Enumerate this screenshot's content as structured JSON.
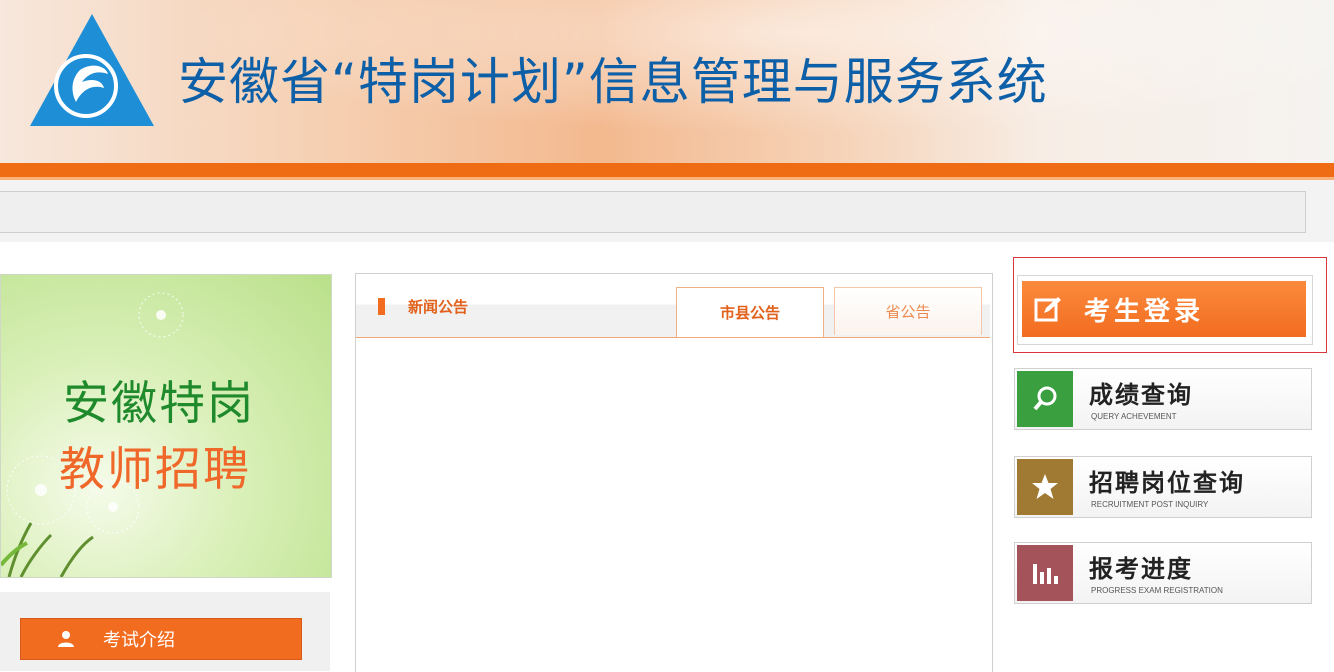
{
  "header": {
    "title": "安徽省“特岗计划”信息管理与服务系统",
    "logo_icon": "anhui-education-logo"
  },
  "banner": {
    "line1": "安徽特岗",
    "line2": "教师招聘"
  },
  "left_menu": {
    "intro_label": "考试介绍",
    "intro_icon": "user-icon"
  },
  "news": {
    "title": "新闻公告",
    "tabs": [
      {
        "label": "市县公告",
        "active": true
      },
      {
        "label": "省公告",
        "active": false
      }
    ]
  },
  "side": {
    "login_label": "考生登录",
    "items": [
      {
        "label": "成绩查询",
        "sub": "QUERY ACHEVEMENT",
        "icon": "search-icon",
        "color": "#3a9f3f"
      },
      {
        "label": "招聘岗位查询",
        "sub": "RECRUITMENT POST INQUIRY",
        "icon": "star-icon",
        "color": "#a07a33"
      },
      {
        "label": "报考进度",
        "sub": "PROGRESS EXAM REGISTRATION",
        "icon": "bar-chart-icon",
        "color": "#a5535a"
      }
    ]
  },
  "colors": {
    "accent": "#f26c20",
    "title_blue": "#0d5fa8",
    "highlight_frame": "#d9363e"
  }
}
